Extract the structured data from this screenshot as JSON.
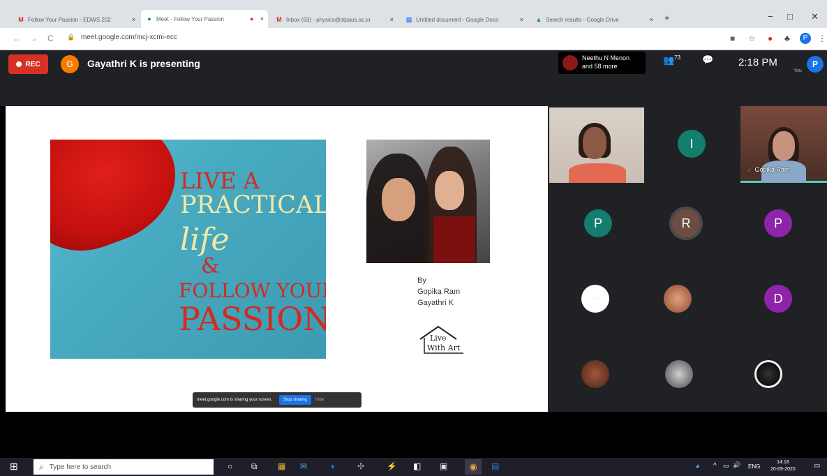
{
  "browser": {
    "tabs": [
      {
        "icon": "M",
        "icon_color": "#d93025",
        "label": "Follow Your Passion - EDWS 202",
        "close": "×"
      },
      {
        "icon": "●",
        "icon_color": "#00897b",
        "label": "Meet - Follow Your Passion",
        "close": "×",
        "rec_dot": "●"
      },
      {
        "icon": "M",
        "icon_color": "#d93025",
        "label": "Inbox (63) - physics@stpaus.ac.in",
        "close": "×"
      },
      {
        "icon": "▤",
        "icon_color": "#4285f4",
        "label": "Untitled document - Google Docs",
        "close": "×"
      },
      {
        "icon": "▲",
        "icon_color": "#0f9d58",
        "label": "Search results - Google Drive",
        "close": "×"
      }
    ],
    "new_tab": "+",
    "window": {
      "minimize": "−",
      "maximize": "□",
      "close": "✕"
    },
    "nav": {
      "back": "←",
      "forward": "→",
      "reload": "C"
    },
    "url": "meet.google.com/mcj-xcmi-ecc",
    "lock": "🔒",
    "extensions": [
      "■",
      "☆",
      "●",
      "♣",
      "P",
      "⋮"
    ]
  },
  "meet": {
    "rec_label": "REC",
    "presenter_initial": "G",
    "presenting_text": "Gayathri K is presenting",
    "participants_card": {
      "line1": "Neethu N Menon",
      "line2": "and 58 more"
    },
    "people_icon": "👥",
    "people_count": "73",
    "chat_icon": "💬",
    "time": "2:18 PM",
    "you_label": "You",
    "self_initial": "P"
  },
  "slide": {
    "poster": [
      "LIVE A",
      "PRACTICAL",
      "life",
      "&",
      "FOLLOW YOUR",
      "PASSION"
    ],
    "credits": [
      "By",
      "Gopika Ram",
      "Gayathri K"
    ],
    "logo_text": [
      "Live",
      "With Art"
    ]
  },
  "share_bar": {
    "text": "meet.google.com is sharing your screen.",
    "stop": "Stop sharing",
    "hide": "Hide"
  },
  "participants": [
    {
      "type": "video"
    },
    {
      "initial": "I",
      "color": "#137d6e"
    },
    {
      "type": "video",
      "name": "Gopika Ram"
    },
    {
      "initial": "P",
      "color": "#137d6e"
    },
    {
      "initial": "R",
      "color": "#6d4c41"
    },
    {
      "initial": "P",
      "color": "#8e24aa"
    },
    {
      "type": "photo",
      "color": "#ffffff"
    },
    {
      "type": "photo",
      "color": "#b0654a"
    },
    {
      "initial": "D",
      "color": "#8e24aa"
    },
    {
      "type": "photo",
      "color": "#6b3b2b"
    },
    {
      "type": "photo",
      "color": "#555555"
    },
    {
      "type": "photo",
      "color": "#222222"
    }
  ],
  "taskbar": {
    "start": "⊞",
    "search_placeholder": "Type here to search",
    "search_icon": "⌕",
    "apps": [
      "○",
      "⧉",
      "▦",
      "✉",
      "◐",
      "✣",
      "⚡",
      "◧",
      "▣",
      "◉",
      "▤"
    ],
    "tray": [
      "◕",
      "^",
      "▭",
      "🔊",
      "ENG"
    ],
    "time": "14:18",
    "date": "20-09-2020",
    "notify": "▭"
  }
}
